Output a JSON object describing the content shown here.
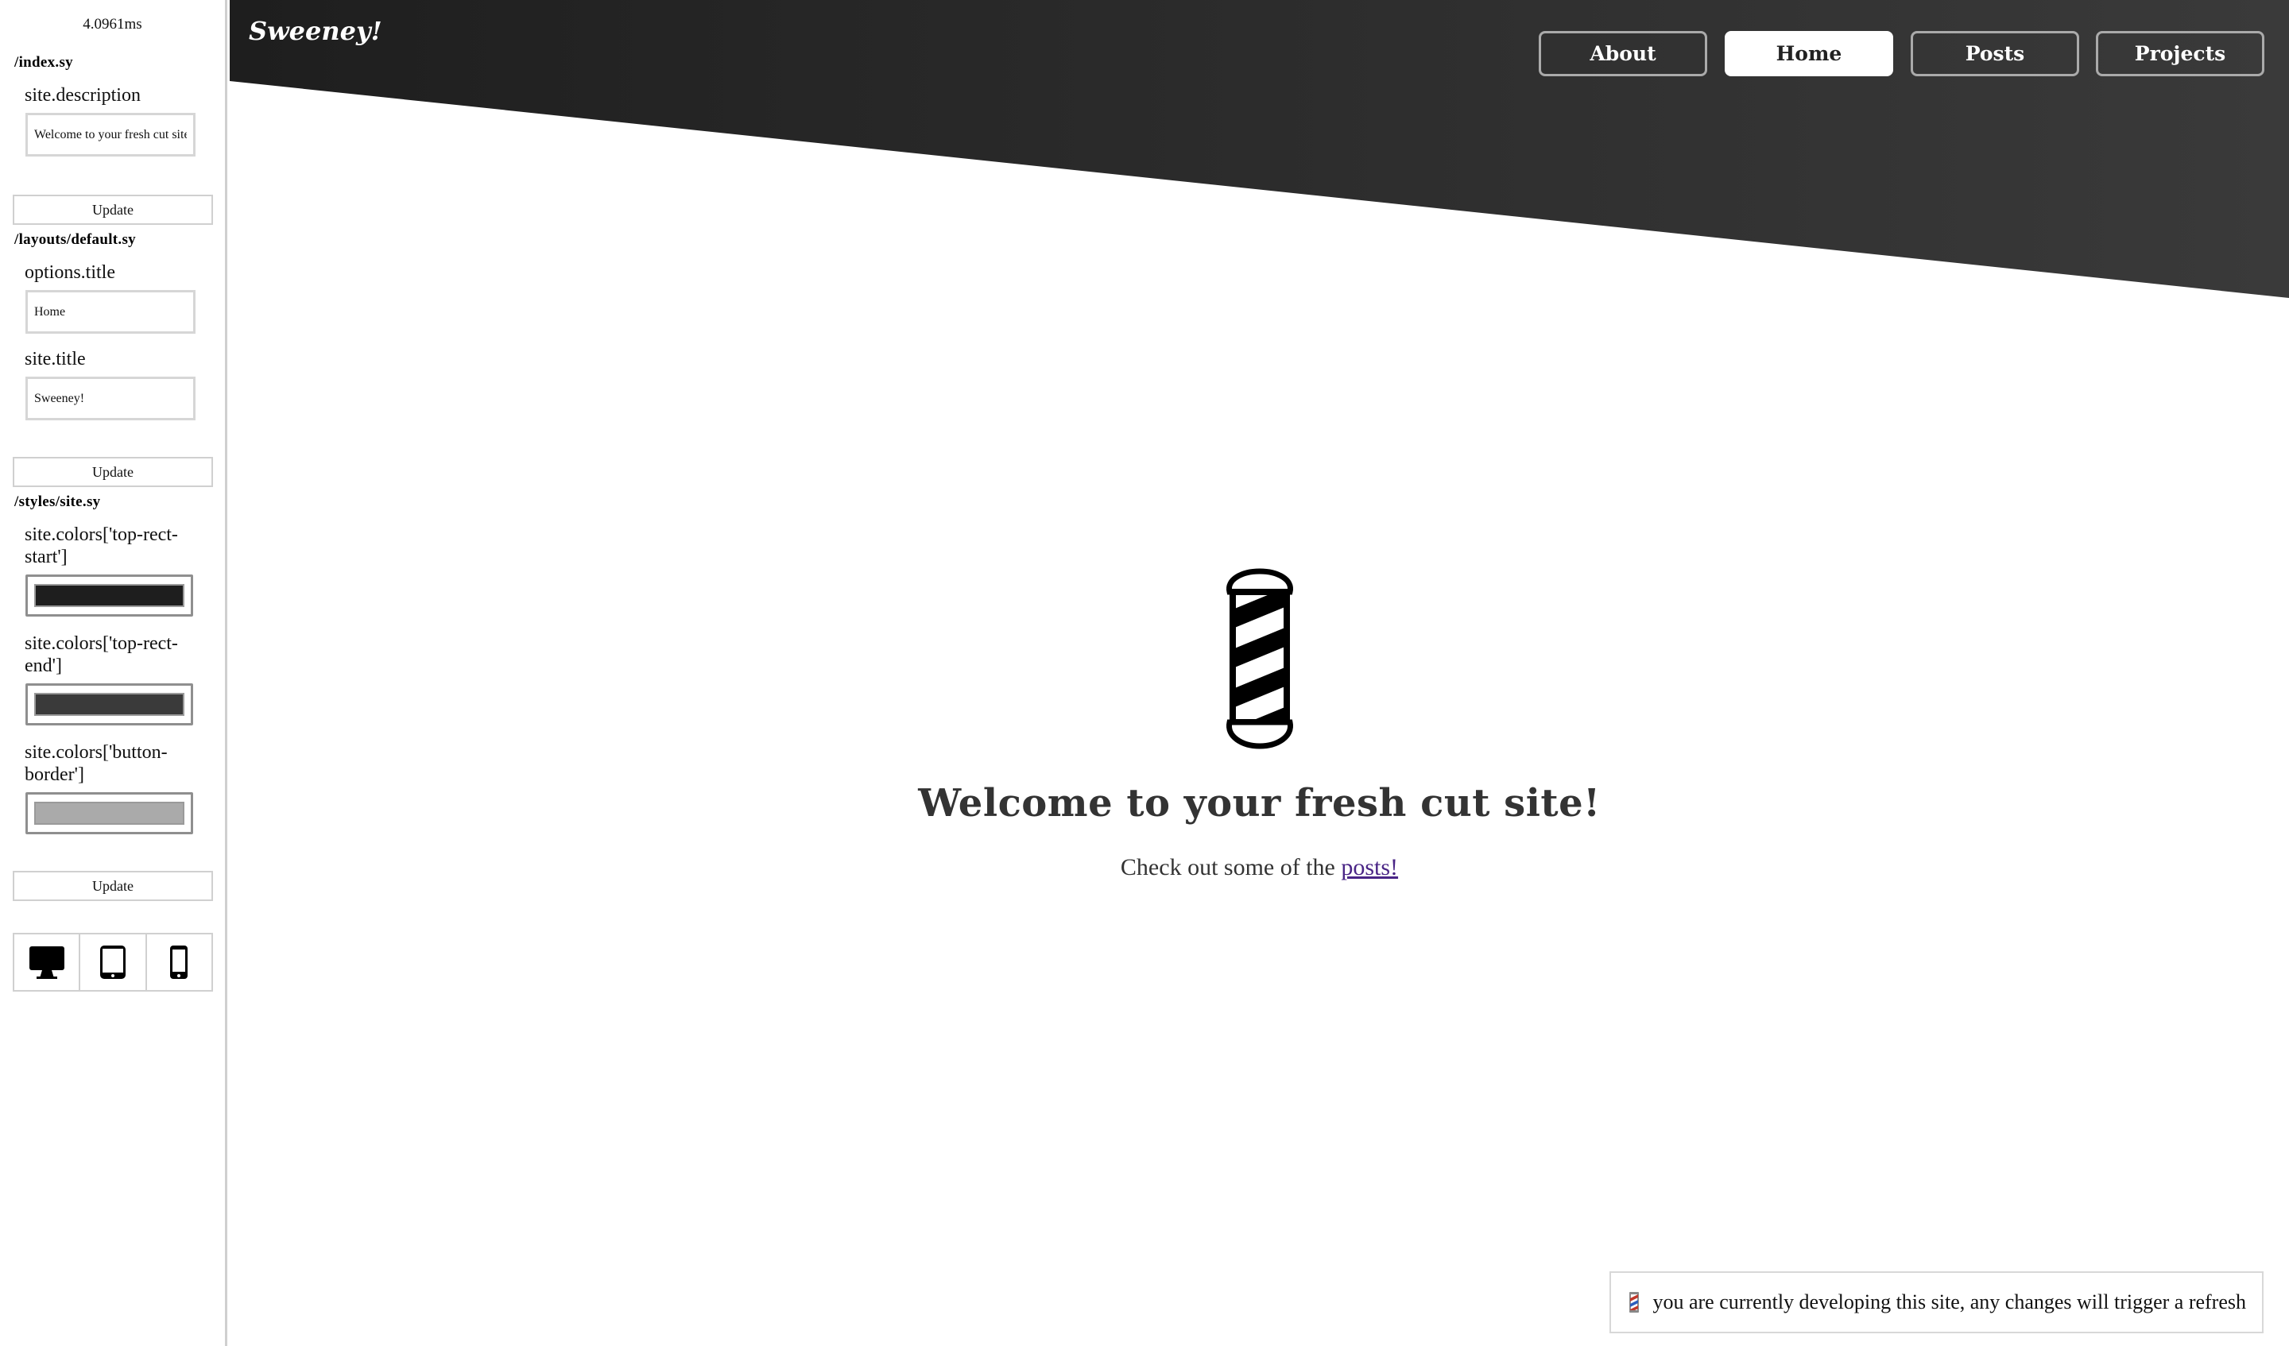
{
  "sidebar": {
    "timing": "4.0961ms",
    "sections": [
      {
        "file": "/index.sy",
        "fields": [
          {
            "label": "site.description",
            "value": "Welcome to your fresh cut site!"
          }
        ],
        "update_label": "Update"
      },
      {
        "file": "/layouts/default.sy",
        "fields": [
          {
            "label": "options.title",
            "value": "Home"
          },
          {
            "label": "site.title",
            "value": "Sweeney!"
          }
        ],
        "update_label": "Update"
      },
      {
        "file": "/styles/site.sy",
        "color_fields": [
          {
            "label": "site.colors['top-rect-start']",
            "color": "#1e1e1e"
          },
          {
            "label": "site.colors['top-rect-end']",
            "color": "#3a3a3a"
          },
          {
            "label": "site.colors['button-border']",
            "color": "#aaaaaa"
          }
        ],
        "update_label": "Update"
      }
    ],
    "devices": [
      "desktop-icon",
      "tablet-icon",
      "phone-icon"
    ]
  },
  "site": {
    "title": "Sweeney!",
    "nav": [
      {
        "label": "About",
        "active": false
      },
      {
        "label": "Home",
        "active": true
      },
      {
        "label": "Posts",
        "active": false
      },
      {
        "label": "Projects",
        "active": false
      }
    ],
    "headline": "Welcome to your fresh cut site!",
    "sub_prefix": "Check out some of the",
    "sub_link": "posts!",
    "toast": "you are currently developing this site, any changes will trigger a refresh",
    "colors": {
      "top_rect_start": "#1e1e1e",
      "top_rect_end": "#3a3a3a",
      "button_border": "#aaaaaa",
      "link": "#4a2586"
    }
  }
}
